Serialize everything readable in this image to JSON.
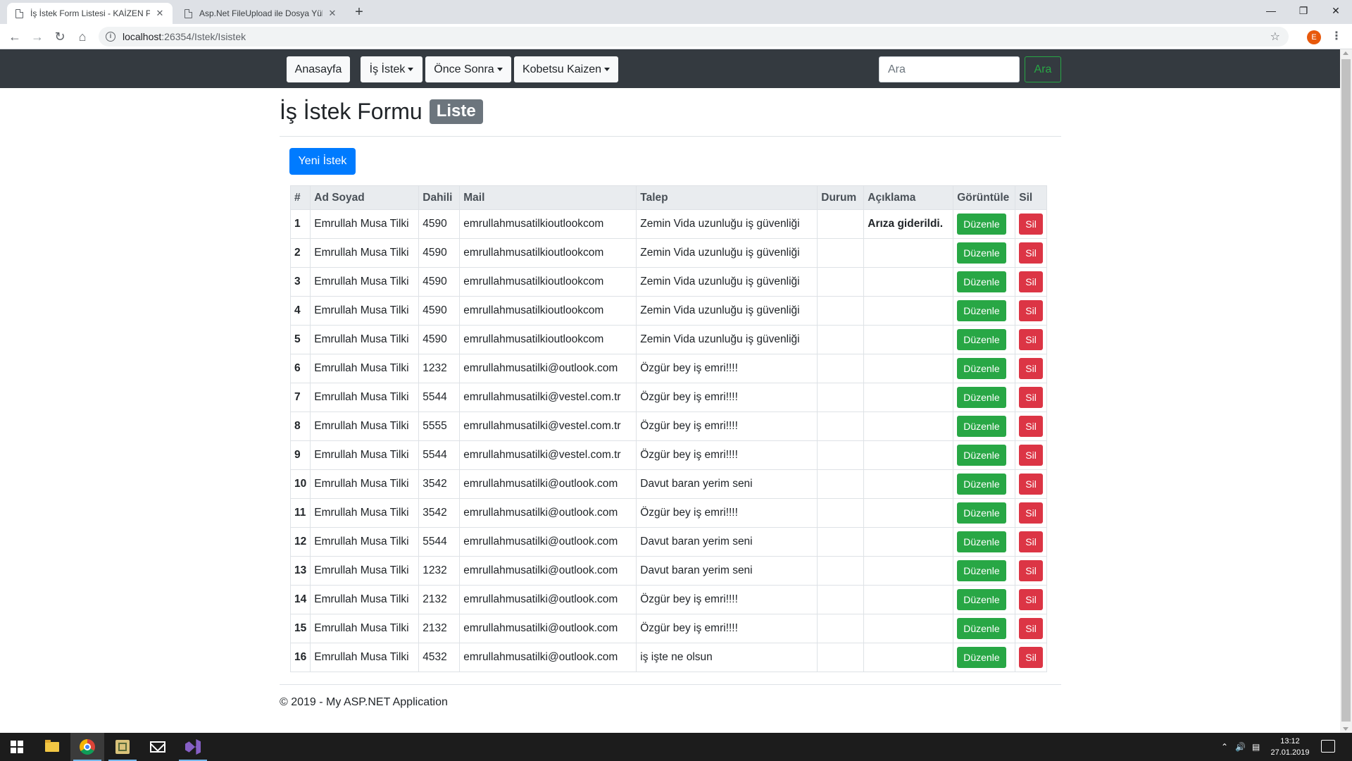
{
  "browser": {
    "tabs": [
      {
        "title": "İş İstek Form Listesi - KAİZEN PO",
        "close": "✕"
      },
      {
        "title": "Asp.Net FileUpload ile Dosya Yük",
        "close": "✕"
      }
    ],
    "new_tab": "+",
    "url_host": "localhost",
    "url_path": ":26354/Istek/Isistek",
    "profile_initial": "E"
  },
  "nav": {
    "items": [
      {
        "label": "Anasayfa",
        "dropdown": false
      },
      {
        "label": "İş İstek",
        "dropdown": true
      },
      {
        "label": "Önce Sonra",
        "dropdown": true
      },
      {
        "label": "Kobetsu Kaizen",
        "dropdown": true
      }
    ],
    "search_placeholder": "Ara",
    "search_button": "Ara"
  },
  "page": {
    "title": "İş İstek Formu",
    "badge": "Liste",
    "new_button": "Yeni İstek"
  },
  "table": {
    "headers": [
      "#",
      "Ad Soyad",
      "Dahili",
      "Mail",
      "Talep",
      "Durum",
      "Açıklama",
      "Görüntüle",
      "Sil"
    ],
    "edit_label": "Düzenle",
    "delete_label": "Sil",
    "rows": [
      {
        "no": "1",
        "name": "Emrullah Musa Tilki",
        "ext": "4590",
        "mail": "emrullahmusatilkioutlookcom",
        "request": "Zemin Vida uzunluğu iş güvenliği",
        "status": "",
        "note": "Arıza giderildi."
      },
      {
        "no": "2",
        "name": "Emrullah Musa Tilki",
        "ext": "4590",
        "mail": "emrullahmusatilkioutlookcom",
        "request": "Zemin Vida uzunluğu iş güvenliği",
        "status": "",
        "note": ""
      },
      {
        "no": "3",
        "name": "Emrullah Musa Tilki",
        "ext": "4590",
        "mail": "emrullahmusatilkioutlookcom",
        "request": "Zemin Vida uzunluğu iş güvenliği",
        "status": "",
        "note": ""
      },
      {
        "no": "4",
        "name": "Emrullah Musa Tilki",
        "ext": "4590",
        "mail": "emrullahmusatilkioutlookcom",
        "request": "Zemin Vida uzunluğu iş güvenliği",
        "status": "",
        "note": ""
      },
      {
        "no": "5",
        "name": "Emrullah Musa Tilki",
        "ext": "4590",
        "mail": "emrullahmusatilkioutlookcom",
        "request": "Zemin Vida uzunluğu iş güvenliği",
        "status": "",
        "note": ""
      },
      {
        "no": "6",
        "name": "Emrullah Musa Tilki",
        "ext": "1232",
        "mail": "emrullahmusatilki@outlook.com",
        "request": "Özgür bey iş emri!!!!",
        "status": "",
        "note": ""
      },
      {
        "no": "7",
        "name": "Emrullah Musa Tilki",
        "ext": "5544",
        "mail": "emrullahmusatilki@vestel.com.tr",
        "request": "Özgür bey iş emri!!!!",
        "status": "",
        "note": ""
      },
      {
        "no": "8",
        "name": "Emrullah Musa Tilki",
        "ext": "5555",
        "mail": "emrullahmusatilki@vestel.com.tr",
        "request": "Özgür bey iş emri!!!!",
        "status": "",
        "note": ""
      },
      {
        "no": "9",
        "name": "Emrullah Musa Tilki",
        "ext": "5544",
        "mail": "emrullahmusatilki@vestel.com.tr",
        "request": "Özgür bey iş emri!!!!",
        "status": "",
        "note": ""
      },
      {
        "no": "10",
        "name": "Emrullah Musa Tilki",
        "ext": "3542",
        "mail": "emrullahmusatilki@outlook.com",
        "request": "Davut baran yerim seni",
        "status": "",
        "note": ""
      },
      {
        "no": "11",
        "name": "Emrullah Musa Tilki",
        "ext": "3542",
        "mail": "emrullahmusatilki@outlook.com",
        "request": "Özgür bey iş emri!!!!",
        "status": "",
        "note": ""
      },
      {
        "no": "12",
        "name": "Emrullah Musa Tilki",
        "ext": "5544",
        "mail": "emrullahmusatilki@outlook.com",
        "request": "Davut baran yerim seni",
        "status": "",
        "note": ""
      },
      {
        "no": "13",
        "name": "Emrullah Musa Tilki",
        "ext": "1232",
        "mail": "emrullahmusatilki@outlook.com",
        "request": "Davut baran yerim seni",
        "status": "",
        "note": ""
      },
      {
        "no": "14",
        "name": "Emrullah Musa Tilki",
        "ext": "2132",
        "mail": "emrullahmusatilki@outlook.com",
        "request": "Özgür bey iş emri!!!!",
        "status": "",
        "note": ""
      },
      {
        "no": "15",
        "name": "Emrullah Musa Tilki",
        "ext": "2132",
        "mail": "emrullahmusatilki@outlook.com",
        "request": "Özgür bey iş emri!!!!",
        "status": "",
        "note": ""
      },
      {
        "no": "16",
        "name": "Emrullah Musa Tilki",
        "ext": "4532",
        "mail": "emrullahmusatilki@outlook.com",
        "request": "iş işte ne olsun",
        "status": "",
        "note": ""
      }
    ]
  },
  "footer": {
    "text": "© 2019 - My ASP.NET Application"
  },
  "taskbar": {
    "apps": [
      "windows-start",
      "file-explorer",
      "chrome",
      "tool-app",
      "mail",
      "visual-studio"
    ],
    "time": "13:12",
    "date": "27.01.2019"
  },
  "colors": {
    "navbar": "#343a40",
    "primary": "#007bff",
    "success": "#28a745",
    "danger": "#dc3545",
    "secondary": "#6c757d"
  }
}
